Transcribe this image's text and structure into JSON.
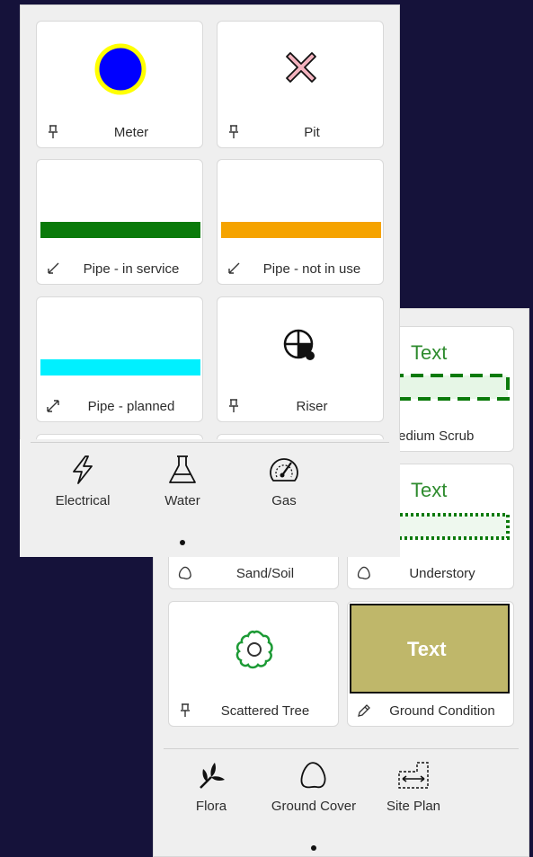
{
  "front_panel": {
    "cards": [
      {
        "label": "Meter",
        "icon": "pin-icon"
      },
      {
        "label": "Pit",
        "icon": "pin-icon"
      },
      {
        "label": "Pipe - in service",
        "icon": "line-arrow-icon",
        "color": "#0a7a0a"
      },
      {
        "label": "Pipe - not in use",
        "icon": "line-arrow-icon",
        "color": "#f5a300"
      },
      {
        "label": "Pipe - planned",
        "icon": "double-arrow-icon",
        "color": "#00f0ff"
      },
      {
        "label": "Riser",
        "icon": "pin-icon"
      }
    ],
    "tabs": [
      {
        "label": "Electrical",
        "icon": "lightning-icon"
      },
      {
        "label": "Water",
        "icon": "flask-icon"
      },
      {
        "label": "Gas",
        "icon": "gauge-icon"
      }
    ]
  },
  "back_panel": {
    "cards": [
      {
        "label": "Medium Scrub",
        "text": "Text",
        "text_color": "#2e8b2e"
      },
      {
        "label": "Understory",
        "text": "Text",
        "text_color": "#2e8b2e"
      },
      {
        "label": "Sand/Soil",
        "icon": "blob-icon"
      },
      {
        "label": "Scattered Tree",
        "icon": "pin-icon"
      },
      {
        "label": "Ground Condition",
        "text": "Text",
        "fill": "#bfb76a"
      }
    ],
    "tabs": [
      {
        "label": "Flora",
        "icon": "leaf-icon"
      },
      {
        "label": "Ground Cover",
        "icon": "blob-icon"
      },
      {
        "label": "Site Plan",
        "icon": "dimension-icon"
      }
    ]
  }
}
